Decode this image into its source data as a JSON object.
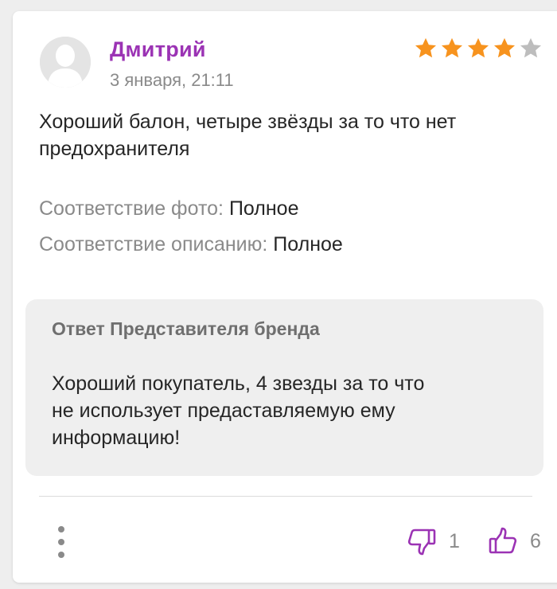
{
  "review": {
    "author": "Дмитрий",
    "date": "3 января, 21:11",
    "rating": 4,
    "rating_max": 5,
    "text": "Хороший балон, четыре звёзды за то что нет\nпредохранителя",
    "attributes": [
      {
        "label": "Соответствие фото:",
        "value": "Полное"
      },
      {
        "label": "Соответствие описанию:",
        "value": "Полное"
      }
    ]
  },
  "reply": {
    "title": "Ответ Представителя бренда",
    "text": "Хороший покупатель, 4 звезды за то что\nне использует предаставляемую ему\nинформацию!"
  },
  "footer": {
    "dislikes": "1",
    "likes": "6"
  },
  "colors": {
    "author": "#9b33b4",
    "star_filled": "#f7931e",
    "star_empty": "#bdbdbd",
    "vote_icon": "#9b33b4"
  },
  "icons": {
    "avatar": "user-silhouette",
    "menu": "more-vertical-icon",
    "dislike": "thumbs-down-icon",
    "like": "thumbs-up-icon"
  }
}
